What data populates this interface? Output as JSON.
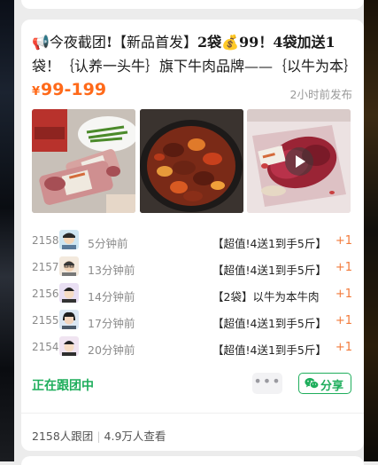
{
  "post": {
    "title_a": "📢今夜截团",
    "title_b": "!",
    "title_c": "【新品首发】",
    "title_d": "2袋",
    "title_e": "💰",
    "title_f": "99！",
    "title_g": "4袋加送1",
    "title_h": "袋！｛认养一头牛｝旗下牛肉品牌——｛以牛为本｝",
    "price_symbol": "¥",
    "price_range": "99-199",
    "posted": "2小时前发布"
  },
  "orders": [
    {
      "num": "2158",
      "time": "5分钟前",
      "content": "【超值!4送1到手5斤】",
      "plus": "+1"
    },
    {
      "num": "2157",
      "time": "13分钟前",
      "content": "【超值!4送1到手5斤】",
      "plus": "+1"
    },
    {
      "num": "2156",
      "time": "14分钟前",
      "content": "【2袋】以牛为本牛肉",
      "plus": "+1"
    },
    {
      "num": "2155",
      "time": "17分钟前",
      "content": "【超值!4送1到手5斤】",
      "plus": "+1"
    },
    {
      "num": "2154",
      "time": "20分钟前",
      "content": "【超值!4送1到手5斤】",
      "plus": "+1"
    }
  ],
  "actions": {
    "following": "正在跟团中",
    "more": "•••",
    "share": "分享"
  },
  "stats": {
    "joined": "2158人跟团",
    "views": "4.9万人查看"
  },
  "colors": {
    "price": "#ff6a1a",
    "accent_green": "#1fae5c",
    "plus": "#f27a3a"
  }
}
